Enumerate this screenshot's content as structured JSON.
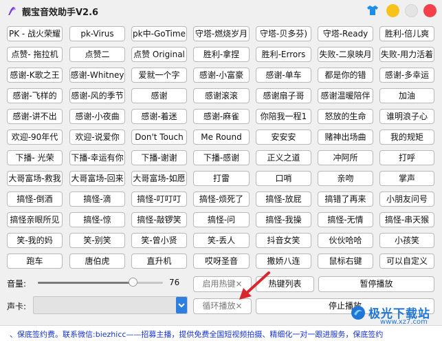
{
  "app": {
    "title": "靓宝音效助手V2.6"
  },
  "sound_buttons": [
    [
      "PK - 战火荣耀",
      "pk-Virus",
      "pk中-GoTime",
      "守塔-燃烧岁月",
      "守塔-贝多芬)",
      "守塔-Ready",
      "胜利-倍儿爽"
    ],
    [
      "点赞- 拖拉机",
      "点赞二",
      "点赞 Original",
      "胜利-拿捏",
      "胜利-Errors",
      "失败-二泉映月",
      "失败-用力活着"
    ],
    [
      "感谢-K歌之王",
      "感谢-Whitney",
      "爱就一个字",
      "感谢-小富豪",
      "感谢-单车",
      "都是你的错",
      "感谢-多幸运"
    ],
    [
      "感谢-飞样的",
      "感谢-风的季节",
      "感谢",
      "感谢滚滚",
      "感谢扇子哥",
      "感谢温暖陪伴",
      "加油"
    ],
    [
      "感谢-讲不出",
      "感谢-小夜曲",
      "感谢-着迷",
      "感谢-麻雀",
      "你陪我一程1",
      "怒放的生命",
      "谁明浪子心"
    ],
    [
      "欢迎-90年代",
      "欢迎-说爱你",
      "Don't Touch",
      "Me Round",
      "安安安",
      "赌神出场曲",
      "我的规矩"
    ],
    [
      "下播- 光荣",
      "下播-幸运有你",
      "下播-谢谢",
      "下播-感谢",
      "正义之道",
      "冲阿所",
      "打呼"
    ],
    [
      "大哥富场-救我",
      "大哥富场-回来",
      "大哥富场-如愿",
      "打雷",
      "口哨",
      "亲吻",
      "掌声"
    ],
    [
      "搞怪-倒酒",
      "搞怪-滴",
      "搞怪-叮叮叮",
      "搞怪-烦死了",
      "搞怪-放屁",
      "搞错了再来",
      "小朋友问号"
    ],
    [
      "搞怪亲眼所见",
      "搞怪-惊",
      "搞怪-敲锣笑",
      "搞怪-问",
      "搞怪-我操",
      "搞怪-无情",
      "搞怪-串天猴"
    ],
    [
      "笑-我的妈",
      "笑-别笑",
      "笑-曾小贤",
      "笑-丢人",
      "抖音女笑",
      "伙伙哈哈",
      "小孩笑"
    ],
    [
      "跑车",
      "唐伯虎",
      "直升机",
      "哎呀圣音",
      "撒娇八连",
      "鼠标右键",
      "可以自定义"
    ]
  ],
  "volume": {
    "label": "音量:",
    "value": 76,
    "display": "76"
  },
  "sound_card": {
    "label": "声卡:",
    "selected": ""
  },
  "controls": {
    "hotkey_enable": "启用热键×",
    "hotkey_list": "热键列表",
    "pause": "暂停播放",
    "loop": "循环播放×",
    "stop": "停止播放"
  },
  "ticker": "、保底签约费。联系微信:biezhicc——招募主播，提供免费全国短视频拍摄、精细化一对一跟进服务，保底签约",
  "watermark": {
    "text": "极光下载站",
    "url": "www.xz7.com"
  },
  "colors": {
    "accent": "#2f7fe0",
    "arrow": "#d9262c",
    "ticker": "#1533d4"
  },
  "icons": {
    "app": "purple-hammer-icon",
    "skin": "shirt-icon",
    "dropdown": "chevron-down-icon"
  }
}
